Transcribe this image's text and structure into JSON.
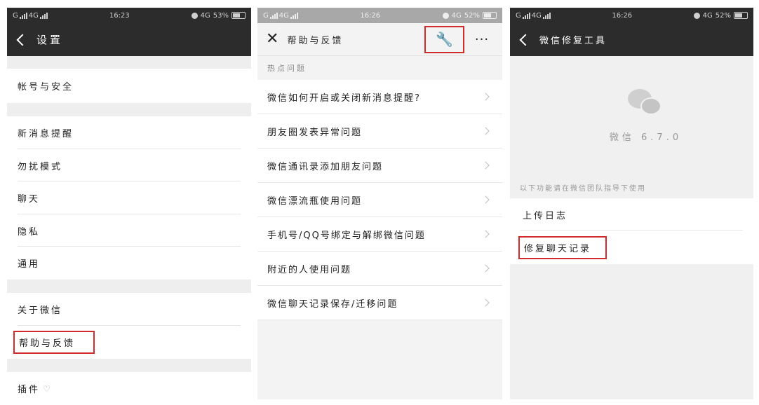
{
  "status_left": "G",
  "status_net": "4G",
  "screen1": {
    "time": "16:23",
    "battery": "53%",
    "title": "设置",
    "items": [
      {
        "label": "帐号与安全"
      },
      {
        "label": "新消息提醒"
      },
      {
        "label": "勿扰模式"
      },
      {
        "label": "聊天"
      },
      {
        "label": "隐私"
      },
      {
        "label": "通用"
      },
      {
        "label": "关于微信"
      },
      {
        "label": "帮助与反馈"
      },
      {
        "label": "插件"
      }
    ]
  },
  "screen2": {
    "time": "16:26",
    "battery": "52%",
    "title": "帮助与反馈",
    "section": "热点问题",
    "questions": [
      {
        "label": "微信如何开启或关闭新消息提醒?"
      },
      {
        "label": "朋友圈发表异常问题"
      },
      {
        "label": "微信通讯录添加朋友问题"
      },
      {
        "label": "微信漂流瓶使用问题"
      },
      {
        "label": "手机号/QQ号绑定与解绑微信问题"
      },
      {
        "label": "附近的人使用问题"
      },
      {
        "label": "微信聊天记录保存/迁移问题"
      }
    ]
  },
  "screen3": {
    "time": "16:26",
    "battery": "52%",
    "title": "微信修复工具",
    "version": "微信 6.7.0",
    "hint": "以下功能请在微信团队指导下使用",
    "items": [
      {
        "label": "上传日志"
      },
      {
        "label": "修复聊天记录"
      }
    ]
  },
  "colors": {
    "highlight": "#d22b2b",
    "navbar_dark": "#2c2c2c"
  }
}
